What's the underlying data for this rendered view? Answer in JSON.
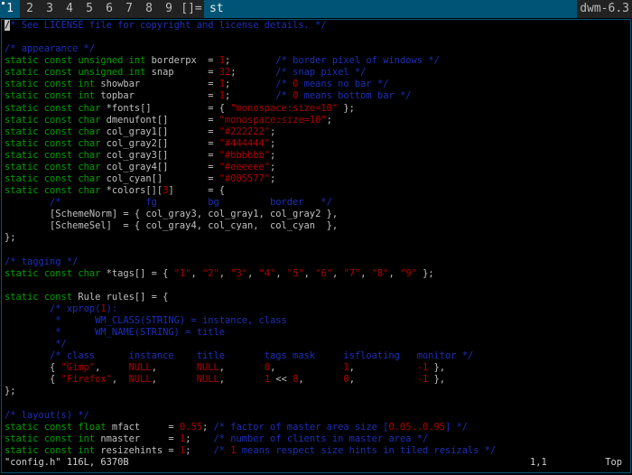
{
  "bar": {
    "tags": [
      "1",
      "2",
      "3",
      "4",
      "5",
      "6",
      "7",
      "8",
      "9"
    ],
    "selected_tag": "1",
    "layout": "[]=",
    "window_title": "st",
    "status": "dwm-6.3",
    "colors": {
      "cyan": "#005577",
      "gray1": "#222222",
      "gray3": "#bbbbbb",
      "gray4": "#eeeeee"
    }
  },
  "editor": {
    "lines": [
      [
        [
          "c",
          "/* See LICENSE file for copyright and license details. */"
        ]
      ],
      [],
      [
        [
          "c",
          "/* appearance */"
        ]
      ],
      [
        [
          "k",
          "static const unsigned int "
        ],
        [
          "p",
          "borderpx  = "
        ],
        [
          "n",
          "1"
        ],
        [
          "p",
          ";        "
        ],
        [
          "c",
          "/* border pixel of windows */"
        ]
      ],
      [
        [
          "k",
          "static const unsigned int "
        ],
        [
          "p",
          "snap      = "
        ],
        [
          "n",
          "32"
        ],
        [
          "p",
          ";       "
        ],
        [
          "c",
          "/* snap pixel */"
        ]
      ],
      [
        [
          "k",
          "static const int "
        ],
        [
          "p",
          "showbar            = "
        ],
        [
          "n",
          "1"
        ],
        [
          "p",
          ";        "
        ],
        [
          "c",
          "/* "
        ],
        [
          "n",
          "0"
        ],
        [
          "c",
          " means no bar */"
        ]
      ],
      [
        [
          "k",
          "static const int "
        ],
        [
          "p",
          "topbar             = "
        ],
        [
          "n",
          "1"
        ],
        [
          "p",
          ";        "
        ],
        [
          "c",
          "/* "
        ],
        [
          "n",
          "0"
        ],
        [
          "c",
          " means bottom bar */"
        ]
      ],
      [
        [
          "k",
          "static const char "
        ],
        [
          "p",
          "*fonts[]          = { "
        ],
        [
          "s",
          "\"monospace:size=10\""
        ],
        [
          "p",
          " };"
        ]
      ],
      [
        [
          "k",
          "static const char "
        ],
        [
          "p",
          "dmenufont[]       = "
        ],
        [
          "s",
          "\"monospace:size=10\""
        ],
        [
          "p",
          ";"
        ]
      ],
      [
        [
          "k",
          "static const char "
        ],
        [
          "p",
          "col_gray1[]       = "
        ],
        [
          "s",
          "\"#222222\""
        ],
        [
          "p",
          ";"
        ]
      ],
      [
        [
          "k",
          "static const char "
        ],
        [
          "p",
          "col_gray2[]       = "
        ],
        [
          "s",
          "\"#444444\""
        ],
        [
          "p",
          ";"
        ]
      ],
      [
        [
          "k",
          "static const char "
        ],
        [
          "p",
          "col_gray3[]       = "
        ],
        [
          "s",
          "\"#bbbbbb\""
        ],
        [
          "p",
          ";"
        ]
      ],
      [
        [
          "k",
          "static const char "
        ],
        [
          "p",
          "col_gray4[]       = "
        ],
        [
          "s",
          "\"#eeeeee\""
        ],
        [
          "p",
          ";"
        ]
      ],
      [
        [
          "k",
          "static const char "
        ],
        [
          "p",
          "col_cyan[]        = "
        ],
        [
          "s",
          "\"#005577\""
        ],
        [
          "p",
          ";"
        ]
      ],
      [
        [
          "k",
          "static const char "
        ],
        [
          "p",
          "*colors[]["
        ],
        [
          "n",
          "3"
        ],
        [
          "p",
          "]      = {"
        ]
      ],
      [
        [
          "p",
          "        "
        ],
        [
          "c",
          "/*               fg         bg         border   */"
        ]
      ],
      [
        [
          "p",
          "        [SchemeNorm] = { col_gray3, col_gray1, col_gray2 },"
        ]
      ],
      [
        [
          "p",
          "        [SchemeSel]  = { col_gray4, col_cyan,  col_cyan  },"
        ]
      ],
      [
        [
          "p",
          "};"
        ]
      ],
      [],
      [
        [
          "c",
          "/* tagging */"
        ]
      ],
      [
        [
          "k",
          "static const char "
        ],
        [
          "p",
          "*tags[] = { "
        ],
        [
          "s",
          "\"1\""
        ],
        [
          "p",
          ", "
        ],
        [
          "s",
          "\"2\""
        ],
        [
          "p",
          ", "
        ],
        [
          "s",
          "\"3\""
        ],
        [
          "p",
          ", "
        ],
        [
          "s",
          "\"4\""
        ],
        [
          "p",
          ", "
        ],
        [
          "s",
          "\"5\""
        ],
        [
          "p",
          ", "
        ],
        [
          "s",
          "\"6\""
        ],
        [
          "p",
          ", "
        ],
        [
          "s",
          "\"7\""
        ],
        [
          "p",
          ", "
        ],
        [
          "s",
          "\"8\""
        ],
        [
          "p",
          ", "
        ],
        [
          "s",
          "\"9\""
        ],
        [
          "p",
          " };"
        ]
      ],
      [],
      [
        [
          "k",
          "static const "
        ],
        [
          "p",
          "Rule rules[] = {"
        ]
      ],
      [
        [
          "p",
          "        "
        ],
        [
          "c",
          "/* xprop("
        ],
        [
          "n",
          "1"
        ],
        [
          "c",
          "):"
        ]
      ],
      [
        [
          "p",
          "        "
        ],
        [
          "c",
          " *      WM_CLASS(STRING) = instance, class"
        ]
      ],
      [
        [
          "p",
          "        "
        ],
        [
          "c",
          " *      WM_NAME(STRING) = title"
        ]
      ],
      [
        [
          "p",
          "        "
        ],
        [
          "c",
          " */"
        ]
      ],
      [
        [
          "p",
          "        "
        ],
        [
          "c",
          "/* class      instance    title       tags mask     isfloating   monitor */"
        ]
      ],
      [
        [
          "p",
          "        { "
        ],
        [
          "s",
          "\"Gimp\""
        ],
        [
          "p",
          ",     "
        ],
        [
          "s",
          "NULL"
        ],
        [
          "p",
          ",       "
        ],
        [
          "s",
          "NULL"
        ],
        [
          "p",
          ",       "
        ],
        [
          "n",
          "0"
        ],
        [
          "p",
          ",            "
        ],
        [
          "n",
          "1"
        ],
        [
          "p",
          ",           "
        ],
        [
          "n",
          "-1"
        ],
        [
          "p",
          " },"
        ]
      ],
      [
        [
          "p",
          "        { "
        ],
        [
          "s",
          "\"Firefox\""
        ],
        [
          "p",
          ",  "
        ],
        [
          "s",
          "NULL"
        ],
        [
          "p",
          ",       "
        ],
        [
          "s",
          "NULL"
        ],
        [
          "p",
          ",       "
        ],
        [
          "n",
          "1"
        ],
        [
          "p",
          " << "
        ],
        [
          "n",
          "8"
        ],
        [
          "p",
          ",       "
        ],
        [
          "n",
          "0"
        ],
        [
          "p",
          ",           "
        ],
        [
          "n",
          "-1"
        ],
        [
          "p",
          " },"
        ]
      ],
      [
        [
          "p",
          "};"
        ]
      ],
      [],
      [
        [
          "c",
          "/* layout(s) */"
        ]
      ],
      [
        [
          "k",
          "static const float "
        ],
        [
          "p",
          "mfact     = "
        ],
        [
          "n",
          "0.55"
        ],
        [
          "p",
          "; "
        ],
        [
          "c",
          "/* factor of master area size ["
        ],
        [
          "n",
          "0.05..0.95"
        ],
        [
          "c",
          "] */"
        ]
      ],
      [
        [
          "k",
          "static const int "
        ],
        [
          "p",
          "nmaster     = "
        ],
        [
          "n",
          "1"
        ],
        [
          "p",
          ";    "
        ],
        [
          "c",
          "/* number of clients in master area */"
        ]
      ],
      [
        [
          "k",
          "static const int "
        ],
        [
          "p",
          "resizehints = "
        ],
        [
          "n",
          "1"
        ],
        [
          "p",
          ";    "
        ],
        [
          "c",
          "/* "
        ],
        [
          "n",
          "1"
        ],
        [
          "c",
          " means respect size hints in tiled resizals */"
        ]
      ]
    ],
    "statusline": {
      "file": "\"config.h\" 116L, 6370B",
      "position": "1,1",
      "scroll": "Top"
    },
    "colors": {
      "keyword": "#00a000",
      "comment": "#1c2fb8",
      "constant": "#b00000",
      "text": "#c0c0c0"
    }
  }
}
